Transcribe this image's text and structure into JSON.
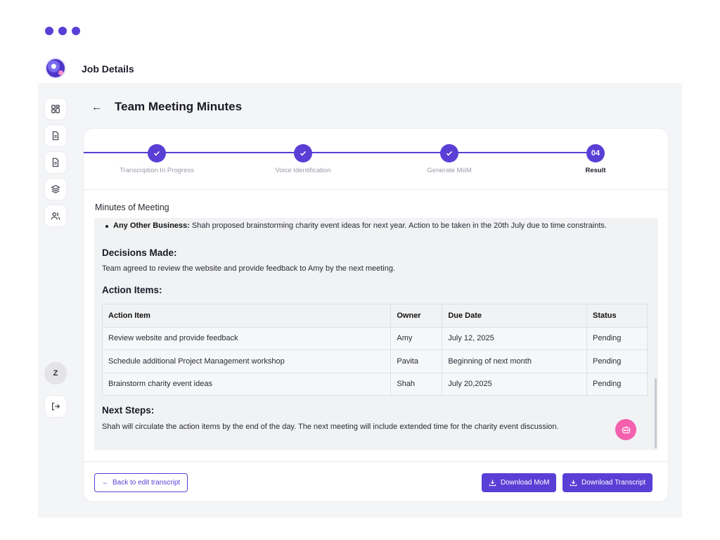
{
  "app": {
    "title": "Job Details"
  },
  "page": {
    "title": "Team Meeting Minutes"
  },
  "sidebar": {
    "items": [
      {
        "icon": "dashboard-icon"
      },
      {
        "icon": "document-icon"
      },
      {
        "icon": "document-icon"
      },
      {
        "icon": "layers-icon"
      },
      {
        "icon": "users-icon"
      }
    ],
    "avatar_initial": "Z",
    "logout_icon": "logout-icon"
  },
  "stepper": {
    "steps": [
      {
        "label": "Transcription In Progress",
        "state": "done"
      },
      {
        "label": "Voice Identification",
        "state": "done"
      },
      {
        "label": "Generate MoM",
        "state": "done"
      },
      {
        "label": "Result",
        "number": "04",
        "state": "active"
      }
    ]
  },
  "mom": {
    "section_label": "Minutes of Meeting",
    "aob_label": "Any Other Business:",
    "aob_text": " Shah proposed brainstorming charity event ideas for next year. Action to be taken in the 20th July due to time constraints.",
    "decisions_heading": "Decisions Made:",
    "decisions_text": "Team agreed to review the website and provide feedback to Amy by the next meeting.",
    "actions_heading": "Action Items:",
    "table": {
      "headers": [
        "Action Item",
        "Owner",
        "Due Date",
        "Status"
      ],
      "rows": [
        [
          "Review website and provide feedback",
          "Amy",
          "July 12, 2025",
          "Pending"
        ],
        [
          "Schedule additional Project Management workshop",
          "Pavita",
          "Beginning of next month",
          "Pending"
        ],
        [
          "Brainstorm charity event ideas",
          "Shah",
          "July 20,2025",
          "Pending"
        ]
      ]
    },
    "next_steps_heading": "Next Steps:",
    "next_steps_text": "Shah will circulate the action items by the end of the day. The next meeting will include extended time for the charity event discussion."
  },
  "footer": {
    "back_label": "Back to edit transcript",
    "download_mom_label": "Download MoM",
    "download_transcript_label": "Download Transcript"
  },
  "colors": {
    "accent": "#5a3fd6",
    "chatbot": "#f45fae",
    "background": "#f4f5f7"
  }
}
